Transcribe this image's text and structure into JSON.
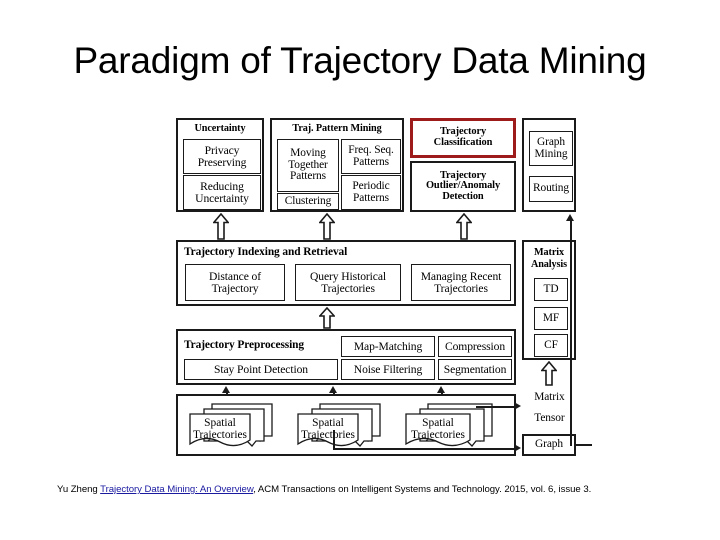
{
  "slide": {
    "title": "Paradigm of Trajectory Data Mining",
    "background_color": "#ffffff",
    "highlight_color": "#9e1b1b",
    "line_color": "#1a1a1a",
    "link_color": "#1a1aa0"
  },
  "citation": {
    "author": "Yu Zheng",
    "link_text": "Trajectory Data Mining: An Overview",
    "rest": " ACM Transactions on Intelligent Systems and Technology. 2015, vol. 6, issue 3.",
    "separator_after_author": " ",
    "separator_after_link": ","
  },
  "diagram": {
    "type": "layered-architecture",
    "tiers": [
      {
        "name": "applications",
        "groups": [
          {
            "id": "uncertainty",
            "header": "Uncertainty",
            "items": [
              "Privacy Preserving",
              "Reducing Uncertainty"
            ]
          },
          {
            "id": "traj-pattern-mining",
            "header": "Traj. Pattern Mining",
            "items": [
              "Moving Together Patterns",
              "Freq. Seq. Patterns",
              "Clustering",
              "Periodic Patterns"
            ]
          },
          {
            "id": "classification-outlier",
            "header": "",
            "items": [
              "Trajectory Classification",
              "Trajectory Outlier/Anomaly Detection"
            ],
            "highlighted_item": "Trajectory Classification"
          },
          {
            "id": "graph-column",
            "header": "",
            "items": [
              "Graph Mining",
              "Routing"
            ]
          }
        ]
      },
      {
        "name": "indexing",
        "groups": [
          {
            "id": "trajectory-indexing",
            "header": "Trajectory Indexing and Retrieval",
            "items": [
              "Distance of Trajectory",
              "Query Historical Trajectories",
              "Managing Recent Trajectories"
            ]
          },
          {
            "id": "matrix-analysis",
            "header": "Matrix Analysis",
            "items": [
              "TD",
              "MF",
              "CF"
            ]
          }
        ]
      },
      {
        "name": "preprocessing",
        "groups": [
          {
            "id": "trajectory-preprocessing",
            "header": "Trajectory Preprocessing",
            "items": [
              "Map-Matching",
              "Compression",
              "Stay Point Detection",
              "Noise Filtering",
              "Segmentation"
            ]
          },
          {
            "id": "data-structures",
            "header": "",
            "items": [
              "Matrix",
              "Tensor",
              "Graph"
            ]
          }
        ]
      },
      {
        "name": "data",
        "groups": [
          {
            "id": "spatial-data",
            "header": "",
            "items": [
              "Spatial Trajectories",
              "Spatial Trajectories",
              "Spatial Trajectories"
            ]
          }
        ]
      }
    ],
    "labels": {
      "uncertainty": "Uncertainty",
      "privacy_preserving": "Privacy Preserving",
      "reducing_uncertainty": "Reducing Uncertainty",
      "traj_pattern_mining": "Traj. Pattern Mining",
      "moving_together": "Moving Together Patterns",
      "freq_seq": "Freq. Seq. Patterns",
      "clustering": "Clustering",
      "periodic": "Periodic Patterns",
      "classification": "Trajectory Classification",
      "outlier": "Trajectory Outlier/Anomaly Detection",
      "graph_mining": "Graph Mining",
      "routing": "Routing",
      "indexing_header": "Trajectory Indexing and Retrieval",
      "distance": "Distance of Trajectory",
      "query_historical": "Query Historical Trajectories",
      "managing_recent": "Managing Recent Trajectories",
      "matrix_analysis": "Matrix Analysis",
      "td": "TD",
      "mf": "MF",
      "cf": "CF",
      "preprocessing_header": "Trajectory Preprocessing",
      "map_matching": "Map-Matching",
      "compression": "Compression",
      "stay_point": "Stay Point Detection",
      "noise_filtering": "Noise Filtering",
      "segmentation": "Segmentation",
      "matrix": "Matrix",
      "tensor": "Tensor",
      "graph": "Graph",
      "spatial_trajectories": "Spatial Trajectories"
    }
  }
}
